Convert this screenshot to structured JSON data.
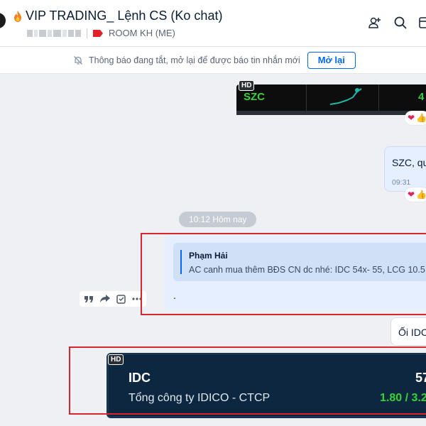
{
  "header": {
    "title": "VIP TRADING_ Lệnh CS (Ko chat)",
    "room_label": "ROOM KH (ME)",
    "icons": [
      "fire-icon",
      "add-member-icon",
      "search-icon",
      "layout-icon"
    ]
  },
  "notice": {
    "text": "Thông báo đang tắt, mở lại để được báo tin nhắn mới",
    "button_label": "Mở lại"
  },
  "messages": {
    "szc_card": {
      "ticker": "SZC",
      "value": "4",
      "hd": "HD"
    },
    "szc_bubble": {
      "text": "SZC, qu",
      "time": "09:31"
    },
    "date_separator": "10:12 Hôm nay",
    "reply": {
      "quoted_author": "Phạm Hải",
      "quoted_text": "AC canh mua thêm BĐS CN dc nhé: IDC 54x- 55, LCG 10.5",
      "text": "."
    },
    "oi_bubble": {
      "text": "Ối IDC"
    },
    "idc_card": {
      "hd": "HD",
      "ticker": "IDC",
      "price": "57",
      "company": "Tổng công ty IDICO - CTCP",
      "change": "1.80 / 3.2"
    }
  },
  "colors": {
    "accent": "#0068ff",
    "highlight_box": "#d9252b",
    "up_green": "#35d435"
  }
}
